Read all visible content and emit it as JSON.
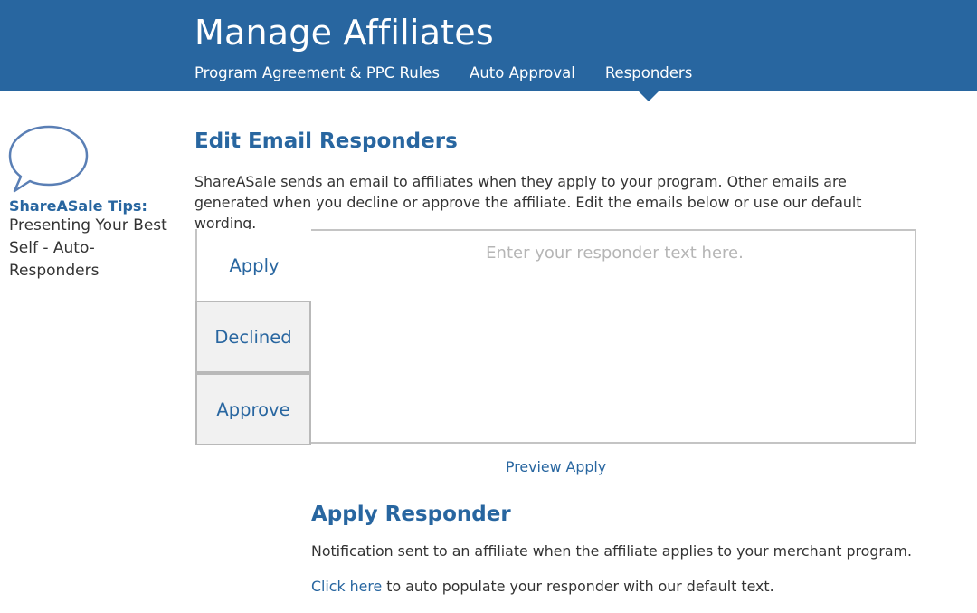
{
  "header": {
    "title": "Manage Affiliates",
    "tabs": [
      {
        "label": "Program Agreement & PPC Rules",
        "active": false
      },
      {
        "label": "Auto Approval",
        "active": false
      },
      {
        "label": "Responders",
        "active": true
      }
    ]
  },
  "tips": {
    "icon": "speech-bubble-icon",
    "heading": "ShareASale Tips:",
    "link": "Presenting Your Best Self - Auto-Responders"
  },
  "main": {
    "section_title": "Edit Email Responders",
    "intro": "ShareASale sends an email to affiliates when they apply to your program. Other emails are generated when you decline or approve the affiliate. Edit the emails below or use our default wording.",
    "responder_tabs": [
      {
        "label": "Apply",
        "active": true
      },
      {
        "label": "Declined",
        "active": false
      },
      {
        "label": "Approve",
        "active": false
      }
    ],
    "editor": {
      "placeholder": "Enter your responder text here.",
      "value": ""
    },
    "preview_link": "Preview Apply"
  },
  "responder": {
    "title": "Apply Responder",
    "description": "Notification sent to an affiliate when the affiliate applies to your merchant program.",
    "click_link": "Click here",
    "click_text": " to auto populate your responder with our default text."
  },
  "colors": {
    "brand_blue": "#2866a0",
    "text": "#333333",
    "border": "#c4c4c4",
    "tab_inactive_bg": "#f1f1f1",
    "placeholder": "#b5b5b5"
  }
}
